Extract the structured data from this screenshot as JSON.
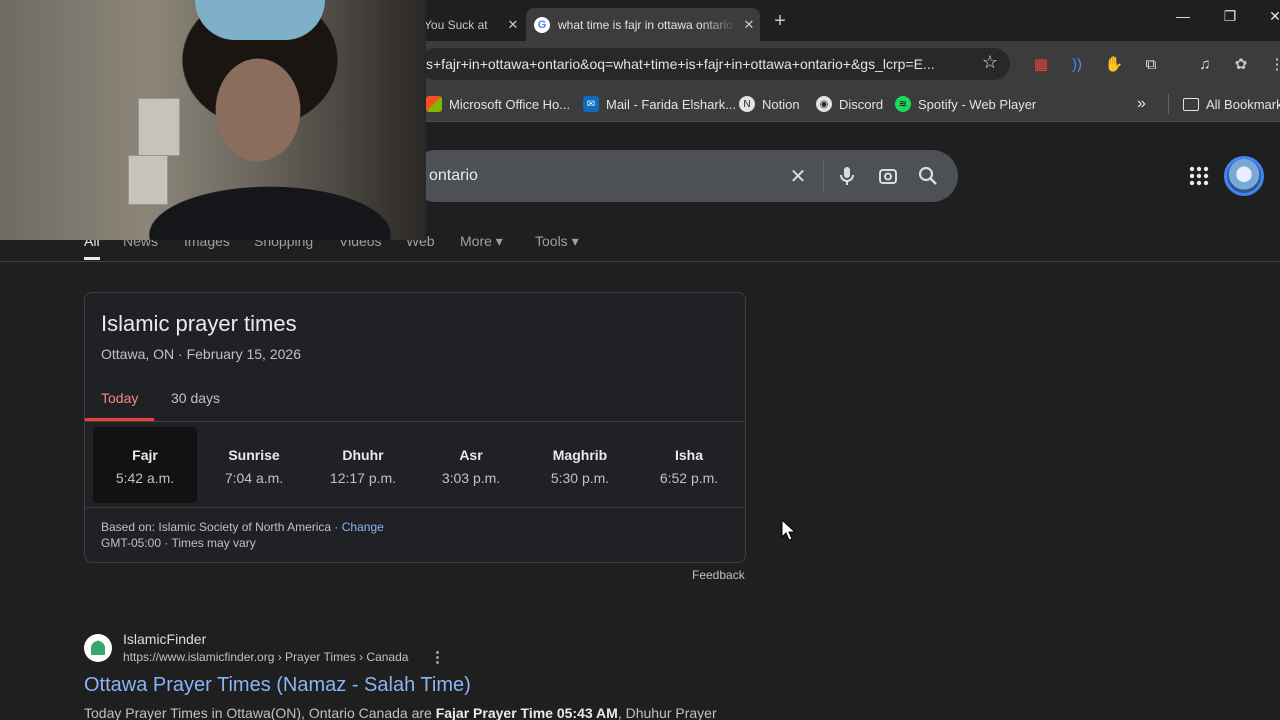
{
  "browser": {
    "tabs": [
      {
        "title": "You Suck at",
        "active": false
      },
      {
        "title": "what time is fajr in ottawa ontario",
        "active": true
      }
    ],
    "new_tab": "+",
    "close_glyph": "✕",
    "url": "s+fajr+in+ottawa+ontario&oq=what+time+is+fajr+in+ottawa+ontario+&gs_lcrp=E...",
    "bookmarks": [
      {
        "label": "Microsoft Office Ho...",
        "icon": "microsoft-office-icon"
      },
      {
        "label": "Mail - Farida Elshark...",
        "icon": "mail-icon"
      },
      {
        "label": "Notion",
        "icon": "notion-icon"
      },
      {
        "label": "Discord",
        "icon": "discord-icon"
      },
      {
        "label": "Spotify - Web Player",
        "icon": "spotify-icon"
      }
    ],
    "bookmarks_overflow": "»",
    "all_bookmarks": "All Bookmark"
  },
  "search": {
    "query": "ontario"
  },
  "filters": [
    {
      "label": "All",
      "active": true
    },
    {
      "label": "News"
    },
    {
      "label": "Images"
    },
    {
      "label": "Shopping"
    },
    {
      "label": "Videos"
    },
    {
      "label": "Web"
    },
    {
      "label": "More ▾"
    },
    {
      "label": "Tools ▾"
    }
  ],
  "prayer_card": {
    "title": "Islamic prayer times",
    "subtitle": "Ottawa, ON · February 15, 2026",
    "tabs": [
      "Today",
      "30 days"
    ],
    "times": [
      {
        "name": "Fajr",
        "time": "5:42 a.m.",
        "selected": true
      },
      {
        "name": "Sunrise",
        "time": "7:04 a.m."
      },
      {
        "name": "Dhuhr",
        "time": "12:17 p.m."
      },
      {
        "name": "Asr",
        "time": "3:03 p.m."
      },
      {
        "name": "Maghrib",
        "time": "5:30 p.m."
      },
      {
        "name": "Isha",
        "time": "6:52 p.m."
      }
    ],
    "based_on": "Based on: Islamic Society of North America · ",
    "change_link": "Change",
    "timezone": "GMT-05:00 · Times may vary"
  },
  "feedback": "Feedback",
  "result": {
    "site_name": "IslamicFinder",
    "url": "https://www.islamicfinder.org › Prayer Times › Canada",
    "title": "Ottawa Prayer Times (Namaz - Salah Time)",
    "snippet_pre": "Today Prayer Times in Ottawa(ON), Ontario Canada are ",
    "snippet_bold": "Fajar Prayer Time 05:43 AM",
    "snippet_post": ", Dhuhur Prayer"
  },
  "colors": {
    "accent_red": "#ea4335",
    "link_blue": "#8ab4f8"
  }
}
